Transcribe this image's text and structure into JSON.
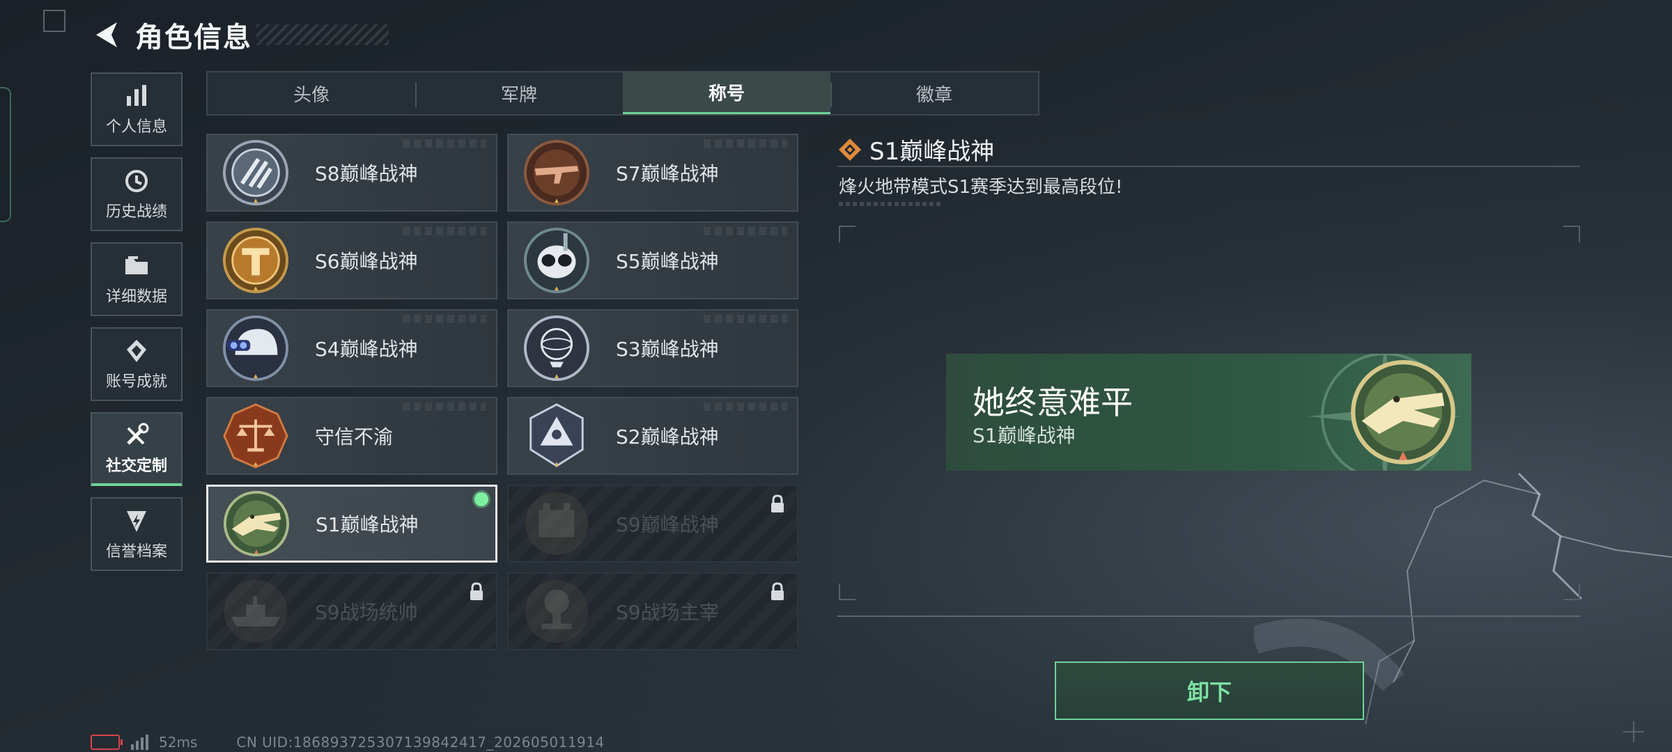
{
  "header": {
    "title": "角色信息"
  },
  "sidebar": {
    "items": [
      {
        "label": "个人信息",
        "icon": "bar-chart-icon",
        "active": false
      },
      {
        "label": "历史战绩",
        "icon": "history-icon",
        "active": false
      },
      {
        "label": "详细数据",
        "icon": "folder-icon",
        "active": false
      },
      {
        "label": "账号成就",
        "icon": "achievement-icon",
        "active": false
      },
      {
        "label": "社交定制",
        "icon": "tools-icon",
        "active": true
      },
      {
        "label": "信誉档案",
        "icon": "shield-lightning-icon",
        "active": false
      }
    ]
  },
  "tabs": [
    {
      "label": "头像",
      "active": false
    },
    {
      "label": "军牌",
      "active": false
    },
    {
      "label": "称号",
      "active": true
    },
    {
      "label": "徽章",
      "active": false
    }
  ],
  "titles": [
    {
      "name": "S8巅峰战神",
      "badge": "s8-stripes-badge",
      "locked": false
    },
    {
      "name": "S7巅峰战神",
      "badge": "s7-rifle-badge",
      "locked": false
    },
    {
      "name": "S6巅峰战神",
      "badge": "s6-shield-badge",
      "locked": false
    },
    {
      "name": "S5巅峰战神",
      "badge": "s5-skull-badge",
      "locked": false
    },
    {
      "name": "S4巅峰战神",
      "badge": "s4-helmet-badge",
      "locked": false
    },
    {
      "name": "S3巅峰战神",
      "badge": "s3-globe-badge",
      "locked": false
    },
    {
      "name": "守信不渝",
      "badge": "scale-badge",
      "locked": false
    },
    {
      "name": "S2巅峰战神",
      "badge": "s2-pyramid-badge",
      "locked": false
    },
    {
      "name": "S1巅峰战神",
      "badge": "s1-crocodile-badge",
      "locked": false,
      "selected": true,
      "equipped": true
    },
    {
      "name": "S9巅峰战神",
      "badge": "s9-fortress-badge",
      "locked": true
    },
    {
      "name": "S9战场统帅",
      "badge": "s9-warship-badge",
      "locked": true
    },
    {
      "name": "S9战场主宰",
      "badge": "s9-explosion-badge",
      "locked": true
    }
  ],
  "detail": {
    "title": "S1巅峰战神",
    "description": "烽火地带模式S1赛季达到最高段位!"
  },
  "nameplate": {
    "player_name": "她终意难平",
    "title": "S1巅峰战神"
  },
  "actions": {
    "unequip_label": "卸下"
  },
  "status_bar": {
    "ping": "52ms",
    "uid": "CN UID:1868937253071398424​17_202605011914"
  },
  "colors": {
    "accent_green": "#6fd39a",
    "equipped_dot": "#7df0a0",
    "battery_low": "#d9434b",
    "diamond_orange": "#e08a3c"
  }
}
